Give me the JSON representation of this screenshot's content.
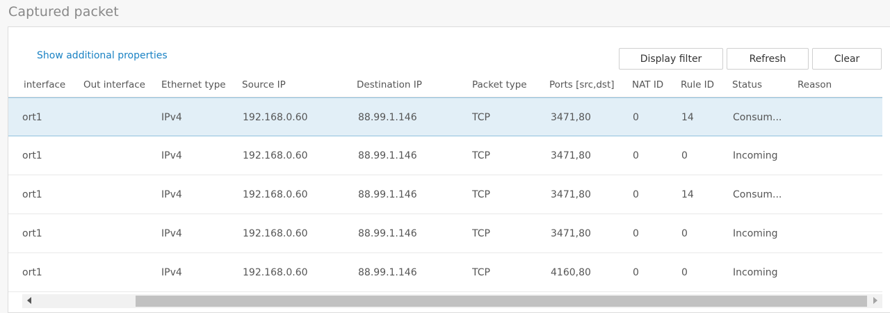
{
  "page": {
    "title": "Captured packet"
  },
  "toolbar": {
    "show_props_label": "Show additional properties",
    "display_filter_label": "Display filter",
    "refresh_label": "Refresh",
    "clear_label": "Clear"
  },
  "table": {
    "columns": [
      "interface",
      "Out interface",
      "Ethernet type",
      "Source IP",
      "Destination IP",
      "Packet type",
      "Ports [src,dst]",
      "NAT ID",
      "Rule ID",
      "Status",
      "Reason"
    ],
    "rows": [
      [
        "ort1",
        "",
        "IPv4",
        "192.168.0.60",
        "88.99.1.146",
        "TCP",
        "3471,80",
        "0",
        "14",
        "Consum...",
        ""
      ],
      [
        "ort1",
        "",
        "IPv4",
        "192.168.0.60",
        "88.99.1.146",
        "TCP",
        "3471,80",
        "0",
        "0",
        "Incoming",
        ""
      ],
      [
        "ort1",
        "",
        "IPv4",
        "192.168.0.60",
        "88.99.1.146",
        "TCP",
        "3471,80",
        "0",
        "14",
        "Consum...",
        ""
      ],
      [
        "ort1",
        "",
        "IPv4",
        "192.168.0.60",
        "88.99.1.146",
        "TCP",
        "3471,80",
        "0",
        "0",
        "Incoming",
        ""
      ],
      [
        "ort1",
        "",
        "IPv4",
        "192.168.0.60",
        "88.99.1.146",
        "TCP",
        "4160,80",
        "0",
        "0",
        "Incoming",
        ""
      ]
    ],
    "selected_row": 0
  },
  "scrollbar": {
    "left_arrow": "scroll-left-icon",
    "right_arrow": "scroll-right-icon"
  }
}
